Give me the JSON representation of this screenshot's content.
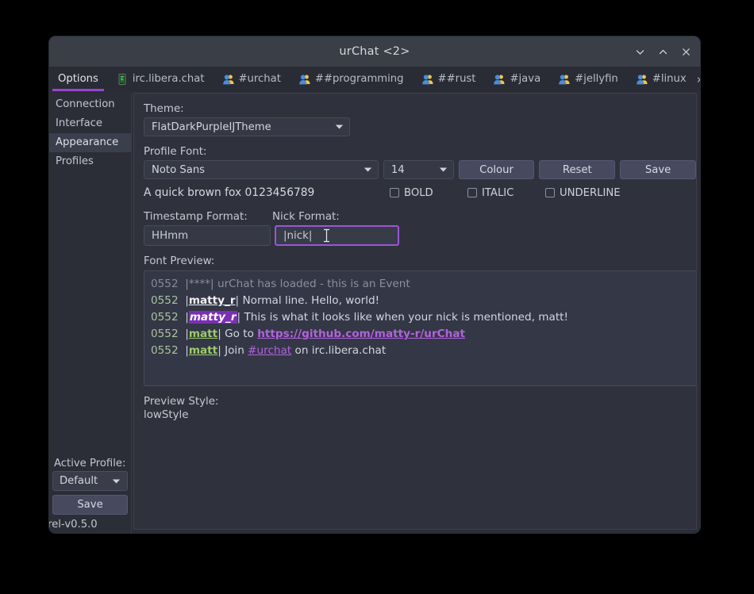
{
  "window": {
    "title": "urChat <2>",
    "controls": [
      {
        "name": "minimize-button",
        "glyph": "chevron-down"
      },
      {
        "name": "maximize-button",
        "glyph": "chevron-up"
      },
      {
        "name": "close-button",
        "glyph": "x"
      }
    ]
  },
  "tabs": [
    {
      "label": "Options",
      "icon": "none",
      "active": true
    },
    {
      "label": "irc.libera.chat",
      "icon": "server-icon",
      "active": false
    },
    {
      "label": "#urchat",
      "icon": "group-icon",
      "active": false
    },
    {
      "label": "##programming",
      "icon": "group-icon",
      "active": false
    },
    {
      "label": "##rust",
      "icon": "group-icon",
      "active": false
    },
    {
      "label": "#java",
      "icon": "group-icon",
      "active": false
    },
    {
      "label": "#jellyfin",
      "icon": "group-icon",
      "active": false
    },
    {
      "label": "#linux",
      "icon": "group-icon",
      "active": false
    }
  ],
  "tab_nav": {
    "next": "›",
    "overflow": "⌄"
  },
  "sidebar": {
    "items": [
      {
        "label": "Connection",
        "selected": false
      },
      {
        "label": "Interface",
        "selected": false
      },
      {
        "label": "Appearance",
        "selected": true
      },
      {
        "label": "Profiles",
        "selected": false
      }
    ],
    "active_profile_label": "Active Profile:",
    "active_profile_value": "Default",
    "save_label": "Save",
    "version": "rel-v0.5.0"
  },
  "appearance": {
    "theme_label": "Theme:",
    "theme_value": "FlatDarkPurpleIJTheme",
    "profile_font_label": "Profile Font:",
    "font_family_value": "Noto Sans",
    "font_size_value": "14",
    "colour_button": "Colour",
    "reset_button": "Reset",
    "save_button": "Save",
    "sample_text": "A quick brown fox 0123456789",
    "style_checkboxes": [
      {
        "label": "BOLD",
        "checked": false
      },
      {
        "label": "ITALIC",
        "checked": false
      },
      {
        "label": "UNDERLINE",
        "checked": false
      }
    ],
    "timestamp_label": "Timestamp Format:",
    "timestamp_value": "HHmm",
    "nick_label": "Nick Format:",
    "nick_value": "|nick|",
    "font_preview_label": "Font Preview:",
    "preview_lines": [
      {
        "timestamp": "0552",
        "nick": "****",
        "nick_style": "event",
        "message": "urChat has loaded - this is an Event",
        "message_style": "event"
      },
      {
        "timestamp": "0552",
        "nick": "matty_r",
        "nick_style": "white-bold-underline",
        "message": "Normal line. Hello, world!",
        "message_style": "normal"
      },
      {
        "timestamp": "0552",
        "nick": "matty_r",
        "nick_style": "highlight",
        "message": "This is what it looks like when your nick is mentioned, matt!",
        "message_style": "normal"
      },
      {
        "timestamp": "0552",
        "nick": "matt",
        "nick_style": "green-bold-underline",
        "message_prefix": "Go to ",
        "link": "https://github.com/matty-r/urChat",
        "message_suffix": ""
      },
      {
        "timestamp": "0552",
        "nick": "matt",
        "nick_style": "green-bold-underline",
        "message_prefix": "Join ",
        "link": "#urchat",
        "message_suffix": " on irc.libera.chat"
      }
    ],
    "preview_style_label": "Preview Style:",
    "preview_style_value": "lowStyle"
  },
  "colors": {
    "accent_purple": "#9644d0",
    "focus_purple": "#9b55d6",
    "window_bg": "#2b2e37",
    "titlebar_bg": "#3a3e46",
    "panel_bg": "#2f323c",
    "preview_bg": "#343746",
    "nick_highlight_bg": "#7a30b3",
    "nick_green": "#9ccb6a",
    "link_purple": "#b163dd"
  }
}
